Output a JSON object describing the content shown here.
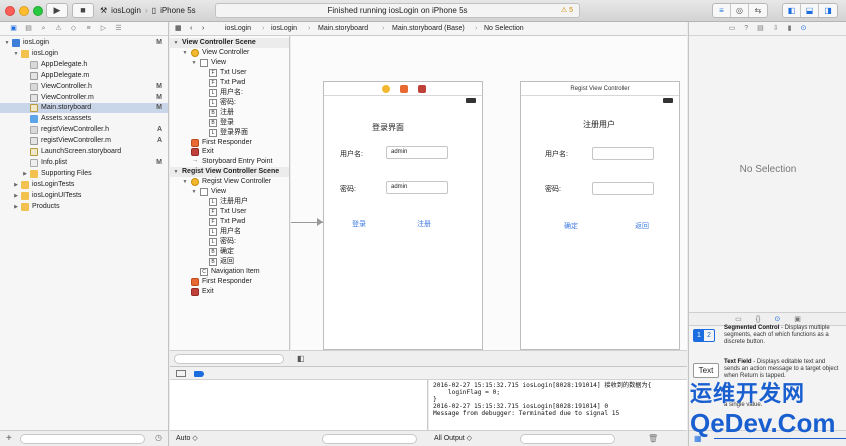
{
  "toolbar": {
    "scheme_target": "iosLogin",
    "scheme_device": "iPhone 5s",
    "status_text": "Finished running iosLogin on iPhone 5s",
    "warning_count": "5"
  },
  "navigator": {
    "rows": [
      {
        "label": "iosLogin",
        "badge": "M",
        "icon": "project-icon",
        "indent": 0,
        "open": true
      },
      {
        "label": "iosLogin",
        "badge": "",
        "icon": "folder-icon",
        "indent": 1,
        "open": true
      },
      {
        "label": "AppDelegate.h",
        "badge": "",
        "icon": "header-file-icon",
        "indent": 2
      },
      {
        "label": "AppDelegate.m",
        "badge": "",
        "icon": "source-file-icon",
        "indent": 2
      },
      {
        "label": "ViewController.h",
        "badge": "M",
        "icon": "header-file-icon",
        "indent": 2
      },
      {
        "label": "ViewController.m",
        "badge": "M",
        "icon": "source-file-icon",
        "indent": 2
      },
      {
        "label": "Main.storyboard",
        "badge": "M",
        "icon": "storyboard-icon",
        "indent": 2,
        "selected": true
      },
      {
        "label": "Assets.xcassets",
        "badge": "",
        "icon": "asset-catalog-icon",
        "indent": 2
      },
      {
        "label": "registViewController.h",
        "badge": "A",
        "icon": "header-file-icon",
        "indent": 2
      },
      {
        "label": "registViewController.m",
        "badge": "A",
        "icon": "source-file-icon",
        "indent": 2
      },
      {
        "label": "LaunchScreen.storyboard",
        "badge": "",
        "icon": "storyboard-icon",
        "indent": 2
      },
      {
        "label": "Info.plist",
        "badge": "M",
        "icon": "plist-icon",
        "indent": 2
      },
      {
        "label": "Supporting Files",
        "badge": "",
        "icon": "folder-icon",
        "indent": 2,
        "closed": true
      },
      {
        "label": "iosLoginTests",
        "badge": "",
        "icon": "folder-icon",
        "indent": 1,
        "closed": true
      },
      {
        "label": "iosLoginUITests",
        "badge": "",
        "icon": "folder-icon",
        "indent": 1,
        "closed": true
      },
      {
        "label": "Products",
        "badge": "",
        "icon": "folder-icon",
        "indent": 1,
        "closed": true
      }
    ]
  },
  "jumpbar": {
    "items": [
      "iosLogin",
      "iosLogin",
      "Main.storyboard",
      "Main.storyboard (Base)",
      "No Selection"
    ]
  },
  "outline": {
    "rows": [
      {
        "label": "View Controller Scene",
        "type": "scene",
        "indent": 0
      },
      {
        "label": "View Controller",
        "type": "vc",
        "indent": 1
      },
      {
        "label": "View",
        "type": "view",
        "indent": 2
      },
      {
        "label": "Txt User",
        "type": "F",
        "indent": 3
      },
      {
        "label": "Txt Pwd",
        "type": "F",
        "indent": 3
      },
      {
        "label": "用户名:",
        "type": "L",
        "indent": 3
      },
      {
        "label": "密码:",
        "type": "L",
        "indent": 3
      },
      {
        "label": "注册",
        "type": "B",
        "indent": 3
      },
      {
        "label": "登录",
        "type": "B",
        "indent": 3
      },
      {
        "label": "登录界面",
        "type": "L",
        "indent": 3
      },
      {
        "label": "First Responder",
        "type": "fr",
        "indent": 1
      },
      {
        "label": "Exit",
        "type": "ex",
        "indent": 1
      },
      {
        "label": "Storyboard Entry Point",
        "type": "entry",
        "indent": 1
      },
      {
        "label": "Regist View Controller Scene",
        "type": "scene",
        "indent": 0
      },
      {
        "label": "Regist View Controller",
        "type": "vc",
        "indent": 1
      },
      {
        "label": "View",
        "type": "view",
        "indent": 2
      },
      {
        "label": "注册用户",
        "type": "L",
        "indent": 3
      },
      {
        "label": "Txt User",
        "type": "F",
        "indent": 3
      },
      {
        "label": "Txt Pwd",
        "type": "F",
        "indent": 3
      },
      {
        "label": "用户名",
        "type": "L",
        "indent": 3
      },
      {
        "label": "密码:",
        "type": "L",
        "indent": 3
      },
      {
        "label": "确定",
        "type": "B",
        "indent": 3
      },
      {
        "label": "返回",
        "type": "B",
        "indent": 3
      },
      {
        "label": "Navigation Item",
        "type": "C",
        "indent": 2
      },
      {
        "label": "First Responder",
        "type": "fr",
        "indent": 1
      },
      {
        "label": "Exit",
        "type": "ex",
        "indent": 1
      }
    ]
  },
  "canvas": {
    "login": {
      "title": "登录界面",
      "user_label": "用户名:",
      "user_value": "admin",
      "pwd_label": "密码:",
      "pwd_value": "admin",
      "login_button": "登录",
      "register_button": "注册"
    },
    "regist": {
      "header": "Regist View Controller",
      "title": "注册用户",
      "user_label": "用户名:",
      "pwd_label": "密码:",
      "confirm_button": "确定",
      "back_button": "返回"
    }
  },
  "debug": {
    "auto_label": "Auto ◇",
    "output_label": "All Output ◇",
    "console_lines": [
      "2016-02-27 15:15:32.715 iosLogin[8028:191014] 接收到的数据为{",
      "    loginFlag = 0;",
      "}",
      "2016-02-27 15:15:32.715 iosLogin[8028:191014] 0",
      "Message from debugger: Terminated due to signal 15"
    ]
  },
  "utilities": {
    "no_selection": "No Selection",
    "library": [
      {
        "title": "Segmented Control",
        "text": " - Displays multiple segments, each of which functions as a discrete button.",
        "thumb": [
          "1",
          "2"
        ]
      },
      {
        "title": "Text Field",
        "text": " - Displays editable text and sends an action message to a target object when Return is tapped.",
        "thumb": [
          "Text"
        ]
      },
      {
        "title": "",
        "text": "a single value.",
        "thumb": []
      }
    ]
  },
  "watermark": {
    "line1": "运维开发网",
    "line2": "QeDev.Com"
  },
  "colors": {
    "accent": "#1b6ddf",
    "selection": "#c9d5e8",
    "link": "#3d7ae0"
  }
}
